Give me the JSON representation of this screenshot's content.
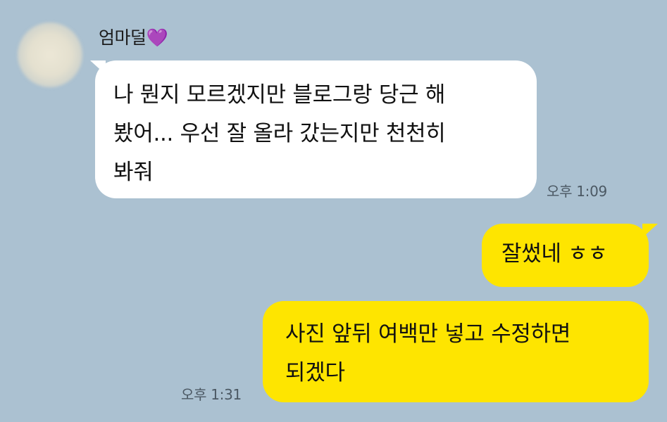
{
  "chat": {
    "sender_name": "엄마덜",
    "sender_emoji": "💜",
    "messages": [
      {
        "direction": "incoming",
        "text": "나 뭔지 모르겠지만 블로그랑 당근 해\n봤어... 우선 잘 올라 갔는지만 천천히\n봐줘",
        "time": "오후 1:09"
      },
      {
        "direction": "outgoing",
        "text": "잘썼네 ㅎㅎ"
      },
      {
        "direction": "outgoing",
        "text": "사진 앞뒤 여백만 넣고 수정하면\n되겠다",
        "time": "오후 1:31"
      }
    ]
  },
  "colors": {
    "background": "#abc1d1",
    "incoming_bubble": "#ffffff",
    "outgoing_bubble": "#fee500",
    "timestamp": "#4b5863"
  }
}
